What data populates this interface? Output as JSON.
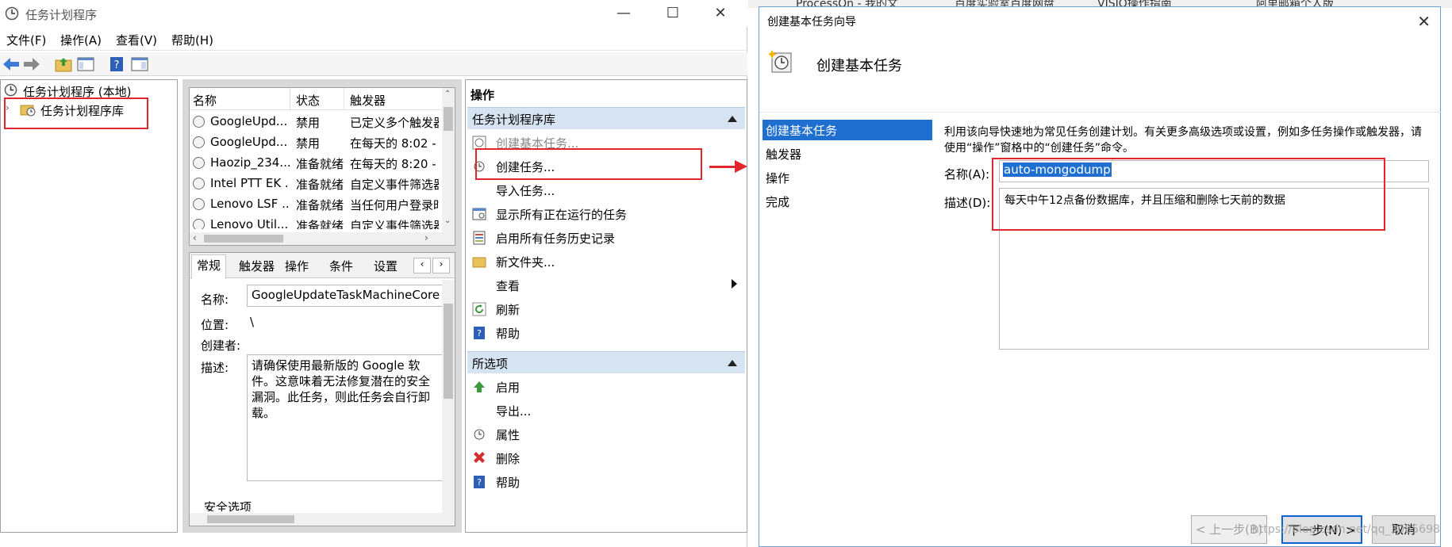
{
  "main_window": {
    "title": "任务计划程序",
    "min_glyph": "—",
    "max_glyph": "☐",
    "close_glyph": "✕",
    "menu": [
      "文件(F)",
      "操作(A)",
      "查看(V)",
      "帮助(H)"
    ]
  },
  "tree": {
    "root": "任务计划程序 (本地)",
    "library": "任务计划程序库"
  },
  "task_list": {
    "columns": [
      "名称",
      "状态",
      "触发器"
    ],
    "rows": [
      {
        "name": "GoogleUpd...",
        "status": "禁用",
        "trigger": "已定义多个触发器"
      },
      {
        "name": "GoogleUpd...",
        "status": "禁用",
        "trigger": "在每天的 8:02 -"
      },
      {
        "name": "Haozip_234...",
        "status": "准备就绪",
        "trigger": "在每天的 8:20 -"
      },
      {
        "name": "Intel PTT EK ...",
        "status": "准备就绪",
        "trigger": "自定义事件筛选器"
      },
      {
        "name": "Lenovo LSF ...",
        "status": "准备就绪",
        "trigger": "当任何用户登录时"
      },
      {
        "name": "Lenovo Util...",
        "status": "准备就绪",
        "trigger": "自定义事件筛选器"
      }
    ]
  },
  "details": {
    "tabs": [
      "常规",
      "触发器",
      "操作",
      "条件",
      "设置"
    ],
    "name_label": "名称:",
    "name_value": "GoogleUpdateTaskMachineCore",
    "location_label": "位置:",
    "location_value": "\\",
    "author_label": "创建者:",
    "desc_label": "描述:",
    "desc_value": "请确保使用最新版的 Google 软件。这意味着无法修复潜在的安全漏洞。此任务，则此任务会自行卸载。",
    "security_label": "安全选项"
  },
  "actions": {
    "title": "操作",
    "section1": "任务计划程序库",
    "items1": [
      "创建基本任务...",
      "创建任务...",
      "导入任务...",
      "显示所有正在运行的任务",
      "启用所有任务历史记录",
      "新文件夹...",
      "查看",
      "刷新",
      "帮助"
    ],
    "section2": "所选项",
    "items2": [
      "启用",
      "导出...",
      "属性",
      "删除",
      "帮助"
    ]
  },
  "background_tabs": [
    "ProcessOn - 我的文",
    "百度实验室百度网盘",
    "VISIO操作指南",
    "阿里邮箱个人版"
  ],
  "wizard": {
    "title": "创建基本任务向导",
    "close_glyph": "✕",
    "heading": "创建基本任务",
    "steps": [
      "创建基本任务",
      "触发器",
      "操作",
      "完成"
    ],
    "intro": "利用该向导快速地为常见任务创建计划。有关更多高级选项或设置，例如多任务操作或触发器，请使用“操作”窗格中的“创建任务”命令。",
    "name_label": "名称(A):",
    "name_value": "auto-mongodump",
    "desc_label": "描述(D):",
    "desc_value": "每天中午12点备份数据库，并且压缩和删除七天前的数据",
    "back_btn": "< 上一步(B)",
    "next_btn": "下一步(N) >",
    "cancel_btn": "取消"
  },
  "watermark": "https://blog.csdn.net/qq_3085698",
  "colors": {
    "highlight_red": "#e0262c",
    "selection_blue": "#1e6fd0"
  }
}
